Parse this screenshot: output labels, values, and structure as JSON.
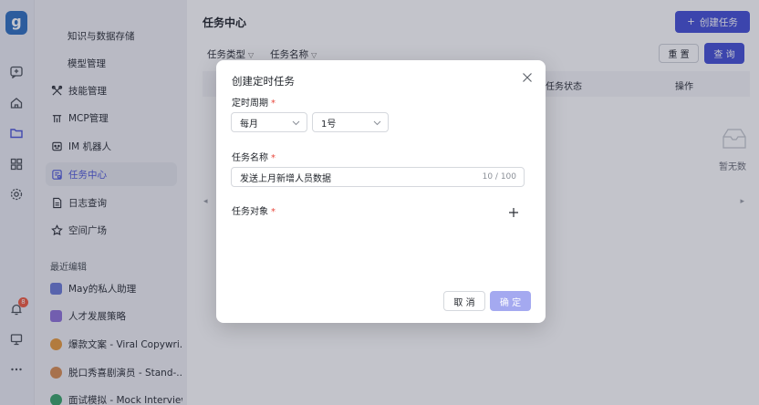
{
  "app": {
    "logo_letter": "g",
    "notification_count": "8"
  },
  "rail_icons": [
    "chat-plus-icon",
    "home-icon",
    "folder-icon",
    "grid-icon",
    "settings-icon",
    "bell-icon",
    "monitor-icon",
    "more-icon"
  ],
  "sidebar": {
    "items": [
      {
        "label": "知识与数据存储",
        "icon": ""
      },
      {
        "label": "模型管理",
        "icon": ""
      },
      {
        "label": "技能管理",
        "icon": "tools-icon"
      },
      {
        "label": "MCP管理",
        "icon": "mcp-icon"
      },
      {
        "label": "IM 机器人",
        "icon": "robot-icon"
      },
      {
        "label": "任务中心",
        "icon": "task-icon",
        "active": true
      },
      {
        "label": "日志查询",
        "icon": "log-icon"
      },
      {
        "label": "空间广场",
        "icon": "star-icon"
      }
    ],
    "recent_heading": "最近编辑",
    "recent": [
      {
        "label": "May的私人助理",
        "color": "#6b7bd6"
      },
      {
        "label": "人才发展策略",
        "color": "#8f72d9"
      },
      {
        "label": "爆款文案 - Viral Copywri...",
        "color": "#e89a3c"
      },
      {
        "label": "脱口秀喜剧演员 - Stand-...",
        "color": "#d98e52"
      },
      {
        "label": "面试模拟 - Mock Interview",
        "color": "#3aa46a"
      }
    ]
  },
  "main": {
    "title": "任务中心",
    "create_button": "创建任务",
    "filters": [
      "任务类型",
      "任务名称"
    ],
    "reset_button": "重 置",
    "query_button": "查 询",
    "columns": {
      "status": "任务状态",
      "operation": "操作"
    },
    "empty_text": "暂无数"
  },
  "modal": {
    "title": "创建定时任务",
    "schedule_label": "定时周期",
    "period_value": "每月",
    "day_value": "1号",
    "name_label": "任务名称",
    "name_value": "发送上月新增人员数据",
    "name_counter": "10 / 100",
    "target_label": "任务对象",
    "required_mark": "*",
    "cancel_button": "取 消",
    "confirm_button": "确 定"
  },
  "colors": {
    "primary": "#4450d6",
    "confirm_disabled": "#a4a9f0",
    "required": "#e8483d",
    "badge": "#f05b40"
  }
}
